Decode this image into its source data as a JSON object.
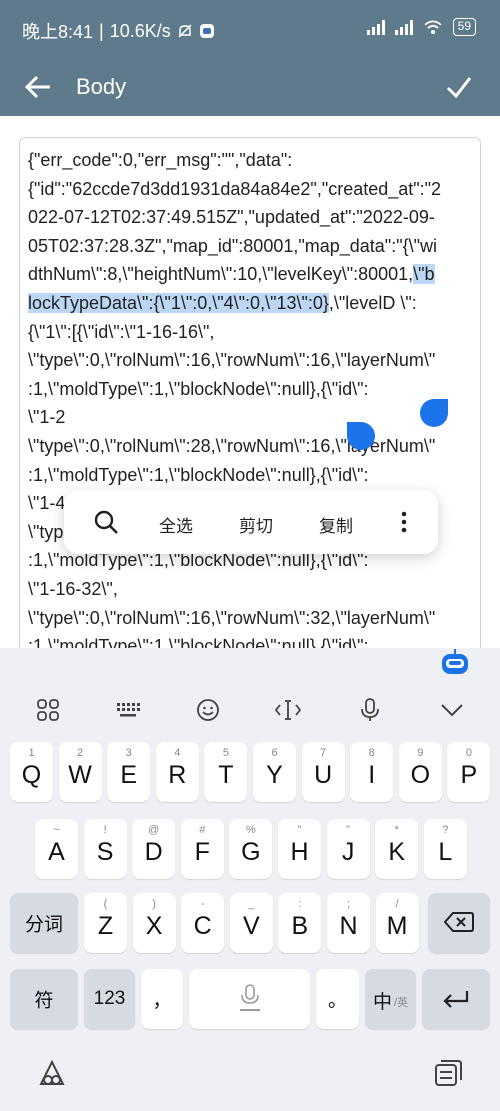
{
  "status": {
    "time": "晚上8:41",
    "speed": "10.6K/s",
    "battery": "59"
  },
  "appbar": {
    "title": "Body"
  },
  "body": {
    "lines": [
      {
        "pre": "{\"err_code\":0,\"err_msg\":\"\",\"data\":",
        "sel": "",
        "post": ""
      },
      {
        "pre": "{\"id\":\"62ccde7d3dd1931da84a84e2\",\"created_at\":\"2",
        "sel": "",
        "post": ""
      },
      {
        "pre": "022-07-12T02:37:49.515Z\",\"updated_at\":\"2022-09-",
        "sel": "",
        "post": ""
      },
      {
        "pre": "05T02:37:28.3Z\",\"map_id\":80001,\"map_data\":\"{\\\"wi",
        "sel": "",
        "post": ""
      },
      {
        "pre": "dthNum\\\":8,\\\"heightNum\\\":10,\\\"levelKey\\\":80001,",
        "sel": "\\\"b",
        "post": ""
      },
      {
        "pre": "",
        "sel": "lockTypeData\\\":{\\\"1\\\":0,\\\"4\\\":0,\\\"13\\\":0}",
        "post": ",\\\"levelD        \\\":"
      },
      {
        "pre": "{\\\"1\\\":[{\\\"id\\\":\\\"1-16-16\\\",",
        "sel": "",
        "post": ""
      },
      {
        "pre": "\\\"type\\\":0,\\\"rolNum\\\":16,\\\"rowNum\\\":16,\\\"layerNum\\\"",
        "sel": "",
        "post": ""
      },
      {
        "pre": ":1,\\\"moldType\\\":1,\\\"blockNode\\\":null},{\\\"id\\\":",
        "sel": "",
        "post": ""
      },
      {
        "pre": "\\\"1-2",
        "sel": "",
        "post": ""
      },
      {
        "pre": "\\\"type\\\":0,\\\"rolNum\\\":28,\\\"rowNum\\\":16,\\\"layerNum\\\"",
        "sel": "",
        "post": ""
      },
      {
        "pre": ":1,\\\"moldType\\\":1,\\\"blockNode\\\":null},{\\\"id\\\":",
        "sel": "",
        "post": ""
      },
      {
        "pre": "\\\"1-40-16\\\",",
        "sel": "",
        "post": ""
      },
      {
        "pre": "\\\"type\\\":0,\\\"rolNum\\\":40,\\\"rowNum\\\":16,\\\"layerNum\\\"",
        "sel": "",
        "post": ""
      },
      {
        "pre": ":1,\\\"moldType\\\":1,\\\"blockNode\\\":null},{\\\"id\\\":",
        "sel": "",
        "post": ""
      },
      {
        "pre": "\\\"1-16-32\\\",",
        "sel": "",
        "post": ""
      },
      {
        "pre": "\\\"type\\\":0,\\\"rolNum\\\":16,\\\"rowNum\\\":32,\\\"layerNum\\\"",
        "sel": "",
        "post": ""
      },
      {
        "pre": ":1,\\\"moldType\\\":1,\\\"blockNode\\\":null},{\\\"id\\\":",
        "sel": "",
        "post": ""
      }
    ]
  },
  "popup": {
    "select_all": "全选",
    "cut": "剪切",
    "copy": "复制"
  },
  "keyboard": {
    "row1": [
      {
        "k": "Q",
        "s": "1"
      },
      {
        "k": "W",
        "s": "2"
      },
      {
        "k": "E",
        "s": "3"
      },
      {
        "k": "R",
        "s": "4"
      },
      {
        "k": "T",
        "s": "5"
      },
      {
        "k": "Y",
        "s": "6"
      },
      {
        "k": "U",
        "s": "7"
      },
      {
        "k": "I",
        "s": "8"
      },
      {
        "k": "O",
        "s": "9"
      },
      {
        "k": "P",
        "s": "0"
      }
    ],
    "row2": [
      {
        "k": "A",
        "s": "~"
      },
      {
        "k": "S",
        "s": "!"
      },
      {
        "k": "D",
        "s": "@"
      },
      {
        "k": "F",
        "s": "#"
      },
      {
        "k": "G",
        "s": "%"
      },
      {
        "k": "H",
        "s": "\""
      },
      {
        "k": "J",
        "s": "\""
      },
      {
        "k": "K",
        "s": "*"
      },
      {
        "k": "L",
        "s": "?"
      }
    ],
    "row3": [
      {
        "k": "Z",
        "s": "("
      },
      {
        "k": "X",
        "s": ")"
      },
      {
        "k": "C",
        "s": "-"
      },
      {
        "k": "V",
        "s": "_"
      },
      {
        "k": "B",
        "s": ":"
      },
      {
        "k": "N",
        "s": ";"
      },
      {
        "k": "M",
        "s": "/"
      }
    ],
    "fenci": "分词",
    "fu": "符",
    "num": "123",
    "comma": "，",
    "period": "。",
    "zh": "中",
    "en": "/英"
  },
  "colors": {
    "accent": "#1a73e8",
    "appbar": "#5f7a8a",
    "selection": "#bcd7f5"
  }
}
